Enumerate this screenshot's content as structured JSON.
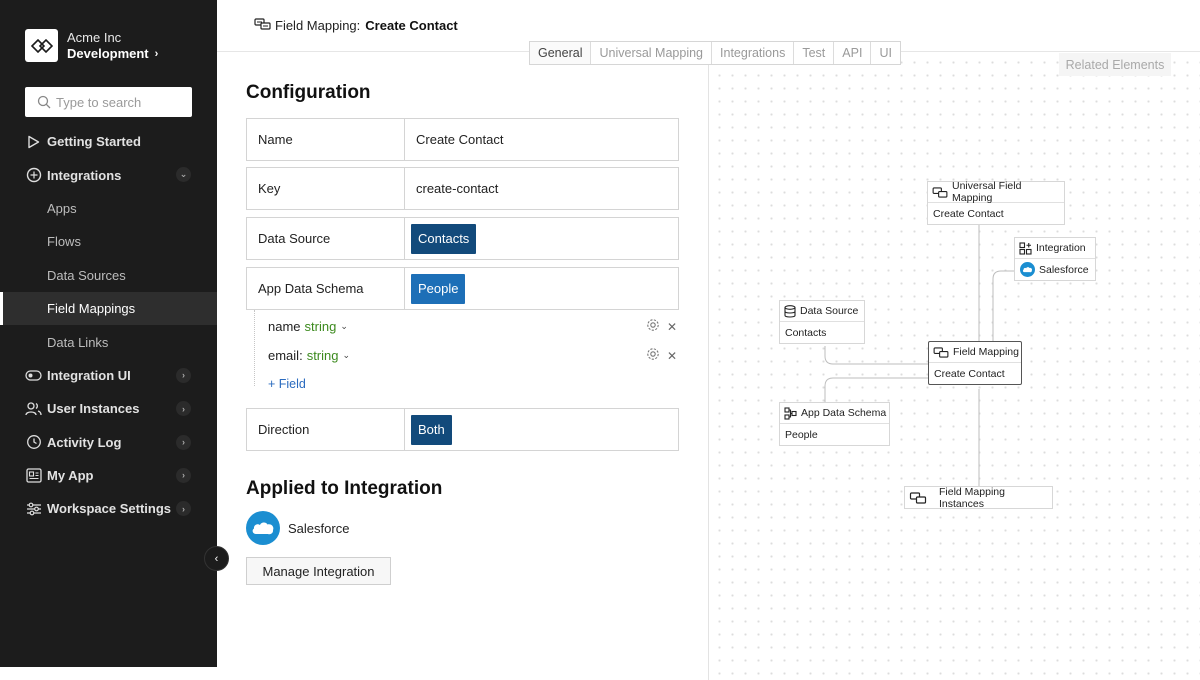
{
  "sidebar": {
    "org_name": "Acme Inc",
    "workspace_name": "Development",
    "search_placeholder": "Type to search",
    "items": [
      {
        "label": "Getting Started",
        "icon": "play-icon"
      },
      {
        "label": "Integrations",
        "icon": "integrations-icon",
        "expanded": true,
        "children": [
          "Apps",
          "Flows",
          "Data Sources",
          "Field Mappings",
          "Data Links"
        ],
        "active_child": "Field Mappings"
      },
      {
        "label": "Integration UI",
        "icon": "toggle-icon"
      },
      {
        "label": "User Instances",
        "icon": "users-icon"
      },
      {
        "label": "Activity Log",
        "icon": "history-icon"
      },
      {
        "label": "My App",
        "icon": "app-icon"
      },
      {
        "label": "Workspace Settings",
        "icon": "sliders-icon"
      }
    ]
  },
  "header": {
    "entity_type": "Field Mapping:",
    "entity_name": "Create Contact"
  },
  "tabs": [
    "General",
    "Universal Mapping",
    "Integrations",
    "Test",
    "API",
    "UI"
  ],
  "active_tab": "General",
  "configuration": {
    "title": "Configuration",
    "name_label": "Name",
    "name_value": "Create Contact",
    "key_label": "Key",
    "key_value": "create-contact",
    "data_source_label": "Data Source",
    "data_source_value": "Contacts",
    "schema_label": "App Data Schema",
    "schema_value": "People",
    "fields": [
      {
        "name": "name",
        "type": "string"
      },
      {
        "name": "email:",
        "type": "string"
      }
    ],
    "add_field": "+ Field",
    "direction_label": "Direction",
    "direction_value": "Both"
  },
  "applied": {
    "title": "Applied to Integration",
    "integration_name": "Salesforce",
    "manage_button": "Manage Integration"
  },
  "graph": {
    "related_button": "Related Elements",
    "nodes": {
      "universal": {
        "title": "Universal Field Mapping",
        "value": "Create Contact"
      },
      "integration": {
        "title": "Integration",
        "value": "Salesforce"
      },
      "data_source": {
        "title": "Data Source",
        "value": "Contacts"
      },
      "field_mapping": {
        "title": "Field Mapping",
        "value": "Create Contact"
      },
      "schema": {
        "title": "App Data Schema",
        "value": "People"
      },
      "instances": {
        "title": "Field Mapping Instances"
      }
    }
  },
  "colors": {
    "sidebar_bg": "#1c1c1c",
    "chip_dark": "#124a7b",
    "chip_blue": "#1d6fb7",
    "type_green": "#3c8a1e",
    "link_blue": "#2a6bbf",
    "salesforce_blue": "#1b8ed1"
  }
}
